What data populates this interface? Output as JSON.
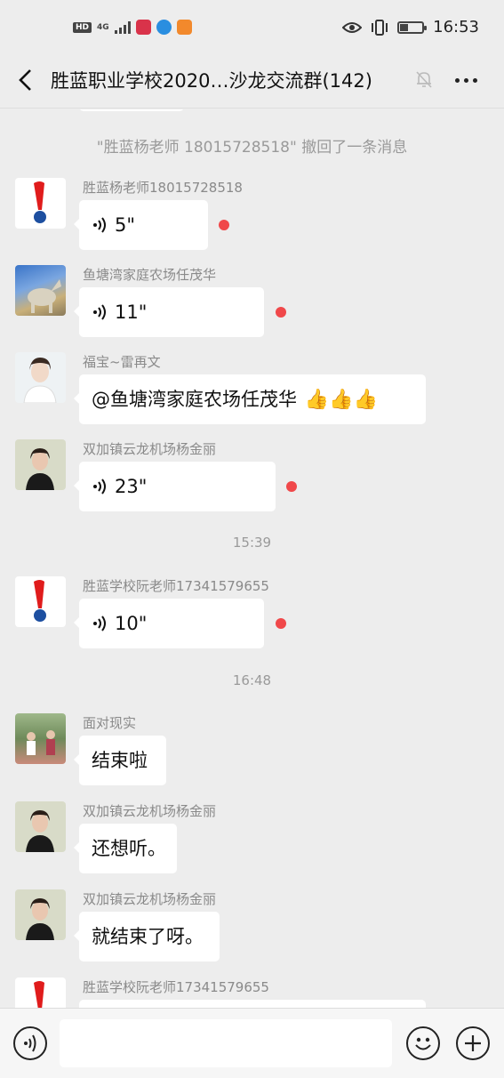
{
  "status_bar": {
    "hd": "HD",
    "network": "4G",
    "time": "16:53",
    "icons": [
      "signal-icon",
      "app-calendar-icon",
      "app-browser-icon",
      "app-video-icon",
      "eye-icon",
      "vibrate-icon",
      "battery-icon"
    ]
  },
  "header": {
    "title": "胜蓝职业学校2020…沙龙交流群(142)",
    "icons": [
      "back-icon",
      "mute-icon",
      "more-icon"
    ]
  },
  "chat": {
    "recall_notice": "\"胜蓝杨老师 18015728518\" 撤回了一条消息",
    "time_1": "15:39",
    "time_2": "16:48",
    "messages": [
      {
        "sender": "胜蓝杨老师18015728518",
        "voice": "5\"",
        "unread": true
      },
      {
        "sender": "鱼塘湾家庭农场任茂华",
        "voice": "11\"",
        "unread": true
      },
      {
        "sender": "福宝~雷再文",
        "text": "@鱼塘湾家庭农场任茂华",
        "emoji": "👍👍👍"
      },
      {
        "sender": "双加镇云龙机场杨金丽",
        "voice": "23\"",
        "unread": true
      },
      {
        "sender": "胜蓝学校阮老师17341579655",
        "voice": "10\"",
        "unread": true
      },
      {
        "sender": "面对现实",
        "text": "结束啦"
      },
      {
        "sender": "双加镇云龙机场杨金丽",
        "text": "还想听。"
      },
      {
        "sender": "双加镇云龙机场杨金丽",
        "text": "就结束了呀。"
      },
      {
        "sender": "胜蓝学校阮老师17341579655",
        "text": ""
      }
    ]
  },
  "input_bar": {
    "placeholder": "",
    "icons": [
      "voice-input-icon",
      "emoji-icon",
      "plus-icon"
    ]
  },
  "colors": {
    "background": "#ededed",
    "bubble": "#ffffff",
    "unread_dot": "#f0484a",
    "meta_text": "#9a9a9a"
  }
}
